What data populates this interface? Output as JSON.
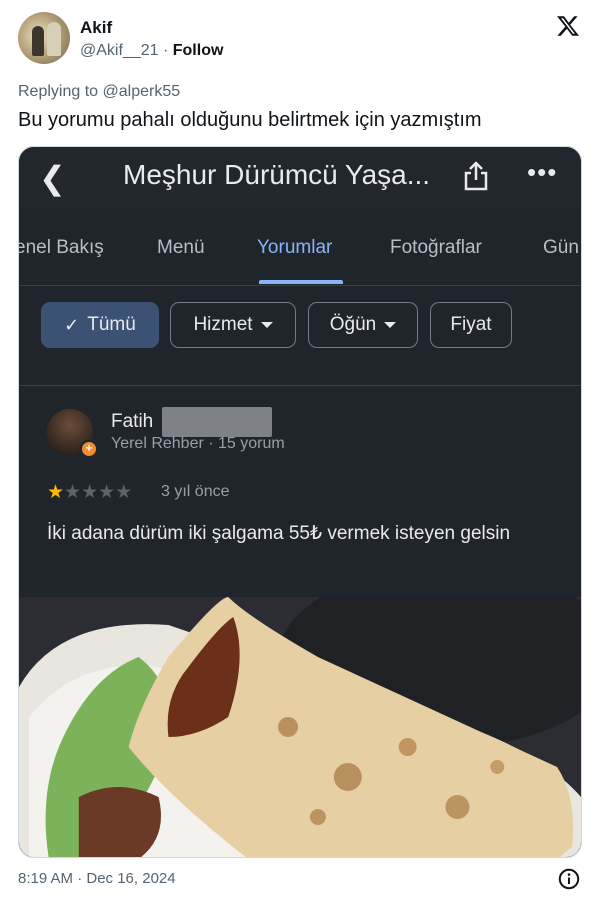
{
  "tweet": {
    "author_name": "Akif",
    "author_handle": "@Akif__21",
    "separator": "·",
    "follow_label": "Follow",
    "replying_prefix": "Replying to",
    "replying_to": "@alperk55",
    "text": "Bu yorumu pahalı olduğunu belirtmek için yazmıştım",
    "timestamp": "8:19 AM · Dec 16, 2024"
  },
  "screenshot": {
    "app_title": "Meşhur Dürümcü Yaşa...",
    "tabs": [
      "enel Bakış",
      "Menü",
      "Yorumlar",
      "Fotoğraflar",
      "Gün"
    ],
    "active_tab": "Yorumlar",
    "filters": [
      {
        "label": "Tümü",
        "selected": true
      },
      {
        "label": "Hizmet",
        "dropdown": true
      },
      {
        "label": "Öğün",
        "dropdown": true
      },
      {
        "label": "Fiyat"
      }
    ],
    "review": {
      "reviewer_name": "Fatih",
      "reviewer_meta": "Yerel Rehber · 15 yorum",
      "rating": 1,
      "rating_max": 5,
      "date": "3 yıl önce",
      "text": "İki adana dürüm iki şalgama 55₺ vermek isteyen gelsin"
    },
    "colors": {
      "background": "#20242b",
      "accent": "#8ab4f8",
      "star": "#fbbc04",
      "chip_selected": "#3c5275"
    }
  },
  "icons": {
    "x_logo": "x-logo-icon",
    "back": "back-chevron-icon",
    "share": "share-icon",
    "more": "more-horizontal-icon",
    "info": "info-icon"
  }
}
